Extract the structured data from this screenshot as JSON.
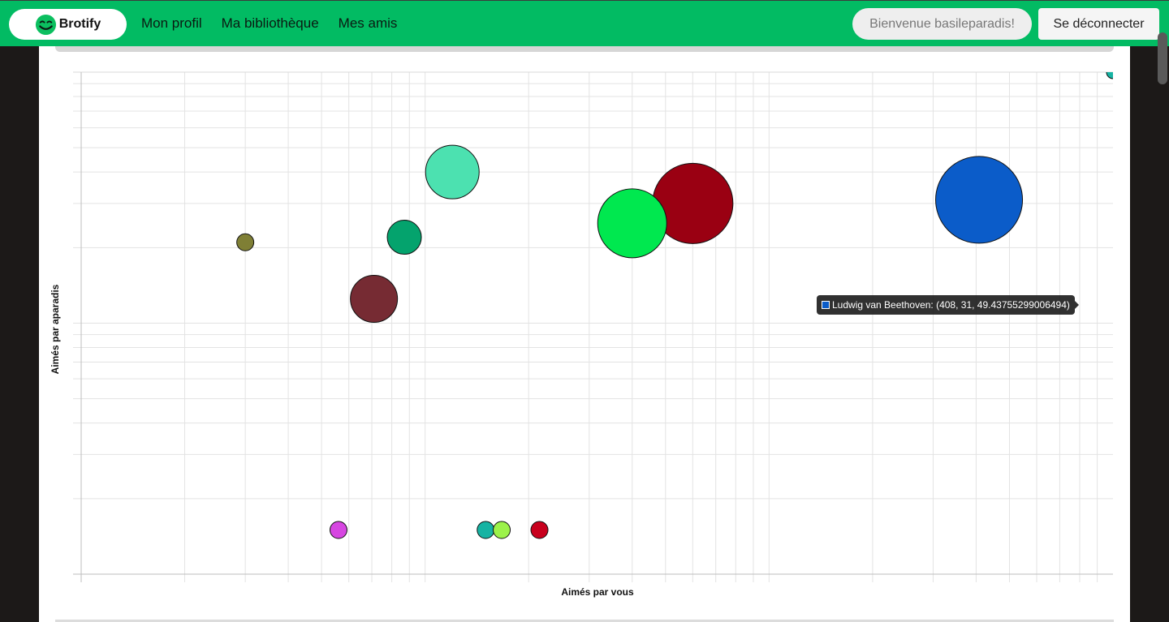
{
  "navbar": {
    "brand": "Brotify",
    "brand_icon": "smiley-icon",
    "links": [
      "Mon profil",
      "Ma bibliothèque",
      "Mes amis"
    ],
    "welcome": "Bienvenue basileparadis!",
    "logout": "Se déconnecter",
    "colors": {
      "navbar": "#02bb63",
      "logo": "#0bbf5f"
    }
  },
  "chart_data": {
    "type": "bubble",
    "xlabel": "Aimés par vous",
    "ylabel": "Aimés par aparadis",
    "x_scale": "log",
    "y_scale": "log",
    "xlim": [
      1,
      1000
    ],
    "ylim": [
      1,
      100
    ],
    "grid": true,
    "points": [
      {
        "x": 1000,
        "y": 100,
        "r": 8,
        "color": "#16b3a3"
      },
      {
        "x": 408,
        "y": 31,
        "r": 53.5,
        "color": "#0b5cc9"
      },
      {
        "x": 60,
        "y": 30,
        "r": 49.5,
        "color": "#9a0012"
      },
      {
        "x": 40,
        "y": 25,
        "r": 42.5,
        "color": "#00e84f"
      },
      {
        "x": 12,
        "y": 40,
        "r": 33,
        "color": "#4ce1b0"
      },
      {
        "x": 8.7,
        "y": 22,
        "r": 21,
        "color": "#04a36d"
      },
      {
        "x": 7.1,
        "y": 12.5,
        "r": 29,
        "color": "#762b33"
      },
      {
        "x": 3,
        "y": 21,
        "r": 10.5,
        "color": "#7f7f35"
      },
      {
        "x": 5.6,
        "y": 1.5,
        "r": 10.5,
        "color": "#d646e1"
      },
      {
        "x": 15,
        "y": 1.5,
        "r": 10.5,
        "color": "#16b3a3"
      },
      {
        "x": 16.7,
        "y": 1.5,
        "r": 10.5,
        "color": "#9cf24a"
      },
      {
        "x": 21.5,
        "y": 1.5,
        "r": 10.5,
        "color": "#c8001d"
      }
    ],
    "tooltip": "Ludwig van Beethoven: (408, 31, 49.43755299006494)",
    "tooltip_color": "#0b5cc9"
  }
}
